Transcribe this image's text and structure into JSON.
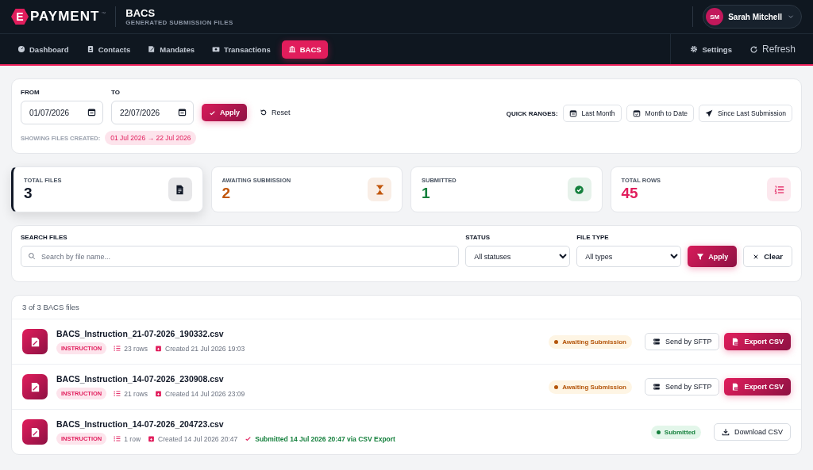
{
  "header": {
    "logo": {
      "mark": "E",
      "text": "PAYMENT",
      "tm": "™"
    },
    "title": "BACS",
    "subtitle": "GENERATED SUBMISSION FILES",
    "user": {
      "initials": "SM",
      "name": "Sarah Mitchell"
    }
  },
  "nav": {
    "items": [
      {
        "label": "Dashboard",
        "kind": "gauge",
        "selected": false
      },
      {
        "label": "Contacts",
        "kind": "contact",
        "selected": false
      },
      {
        "label": "Mandates",
        "kind": "sign",
        "selected": false
      },
      {
        "label": "Transactions",
        "kind": "money",
        "selected": false
      },
      {
        "label": "BACS",
        "kind": "bank",
        "selected": true
      }
    ],
    "settings": "Settings",
    "refresh": "Refresh"
  },
  "date_filter": {
    "from_label": "FROM",
    "from_value": "01/07/2026",
    "to_label": "TO",
    "to_value": "22/07/2026",
    "apply": "Apply",
    "reset": "Reset",
    "showing_label": "SHOWING FILES CREATED:",
    "range": "01 Jul 2026 → 22 Jul 2026",
    "quick_label": "QUICK RANGES:",
    "quick_ranges": [
      {
        "label": "Last Month",
        "kind": "calendar"
      },
      {
        "label": "Month to Date",
        "kind": "calendar-check"
      },
      {
        "label": "Since Last Submission",
        "kind": "send"
      }
    ]
  },
  "stats": [
    {
      "label": "TOTAL FILES",
      "value": "3",
      "kind": "file",
      "color": "#111827",
      "selected": true
    },
    {
      "label": "AWAITING SUBMISSION",
      "value": "2",
      "kind": "hourglass",
      "color": "#c2570c",
      "selected": false
    },
    {
      "label": "SUBMITTED",
      "value": "1",
      "kind": "check",
      "color": "#15803d",
      "selected": false
    },
    {
      "label": "TOTAL ROWS",
      "value": "45",
      "kind": "list",
      "color": "#e11d5c",
      "selected": false
    }
  ],
  "search": {
    "label": "SEARCH FILES",
    "placeholder": "Search by file name...",
    "status_label": "STATUS",
    "status_value": "All statuses",
    "type_label": "FILE TYPE",
    "type_value": "All types",
    "apply": "Apply",
    "clear": "Clear"
  },
  "files": {
    "count": "3 of 3 BACS files",
    "items": [
      {
        "name": "BACS_Instruction_21-07-2026_190332.csv",
        "tag": "INSTRUCTION",
        "rows": "23 rows",
        "created": "Created 21 Jul 2026 19:03",
        "status": {
          "kind": "awaiting",
          "label": "Awaiting Submission"
        },
        "actions": [
          {
            "kind": "sftp",
            "label": "Send by SFTP"
          },
          {
            "kind": "export",
            "label": "Export CSV"
          }
        ]
      },
      {
        "name": "BACS_Instruction_14-07-2026_230908.csv",
        "tag": "INSTRUCTION",
        "rows": "21 rows",
        "created": "Created 14 Jul 2026 23:09",
        "status": {
          "kind": "awaiting",
          "label": "Awaiting Submission"
        },
        "actions": [
          {
            "kind": "sftp",
            "label": "Send by SFTP"
          },
          {
            "kind": "export",
            "label": "Export CSV"
          }
        ]
      },
      {
        "name": "BACS_Instruction_14-07-2026_204723.csv",
        "tag": "INSTRUCTION",
        "rows": "1 row",
        "created": "Created 14 Jul 2026 20:47",
        "submitted": "Submitted 14 Jul 2026 20:47 via CSV Export",
        "status": {
          "kind": "submitted",
          "label": "Submitted"
        },
        "actions": [
          {
            "kind": "download",
            "label": "Download CSV"
          }
        ]
      }
    ]
  }
}
